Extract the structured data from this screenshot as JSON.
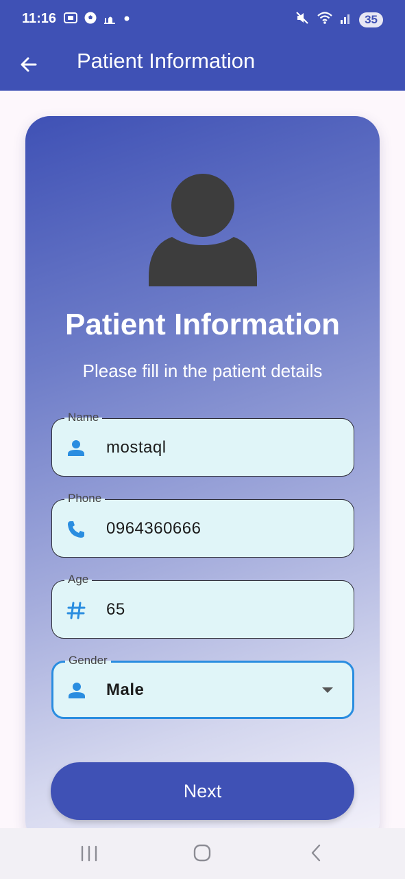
{
  "status_bar": {
    "time": "11:16",
    "battery": "35",
    "icons": [
      "screenshot-icon",
      "soccer-icon",
      "mosque-icon",
      "dot-icon",
      "mute-icon",
      "wifi-icon",
      "signal-icon"
    ]
  },
  "app_bar": {
    "title": "Patient Information",
    "back_icon": "arrow-back-icon"
  },
  "form": {
    "heading": "Patient Information",
    "subheading": "Please fill in the patient details",
    "fields": [
      {
        "label": "Name",
        "value": "mostaql",
        "icon": "person-icon"
      },
      {
        "label": "Phone",
        "value": "0964360666",
        "icon": "phone-icon"
      },
      {
        "label": "Age",
        "value": "65",
        "icon": "hash-icon"
      },
      {
        "label": "Gender",
        "value": "Male",
        "icon": "person-icon",
        "type": "dropdown",
        "focused": true
      }
    ],
    "next_label": "Next"
  },
  "colors": {
    "primary": "#3f51b5",
    "field_fill": "#e0f5f8",
    "accent": "#2a8de0",
    "avatar": "#3d3d3d"
  },
  "nav_bar": {
    "buttons": [
      "recents-icon",
      "home-icon",
      "back-icon"
    ]
  }
}
